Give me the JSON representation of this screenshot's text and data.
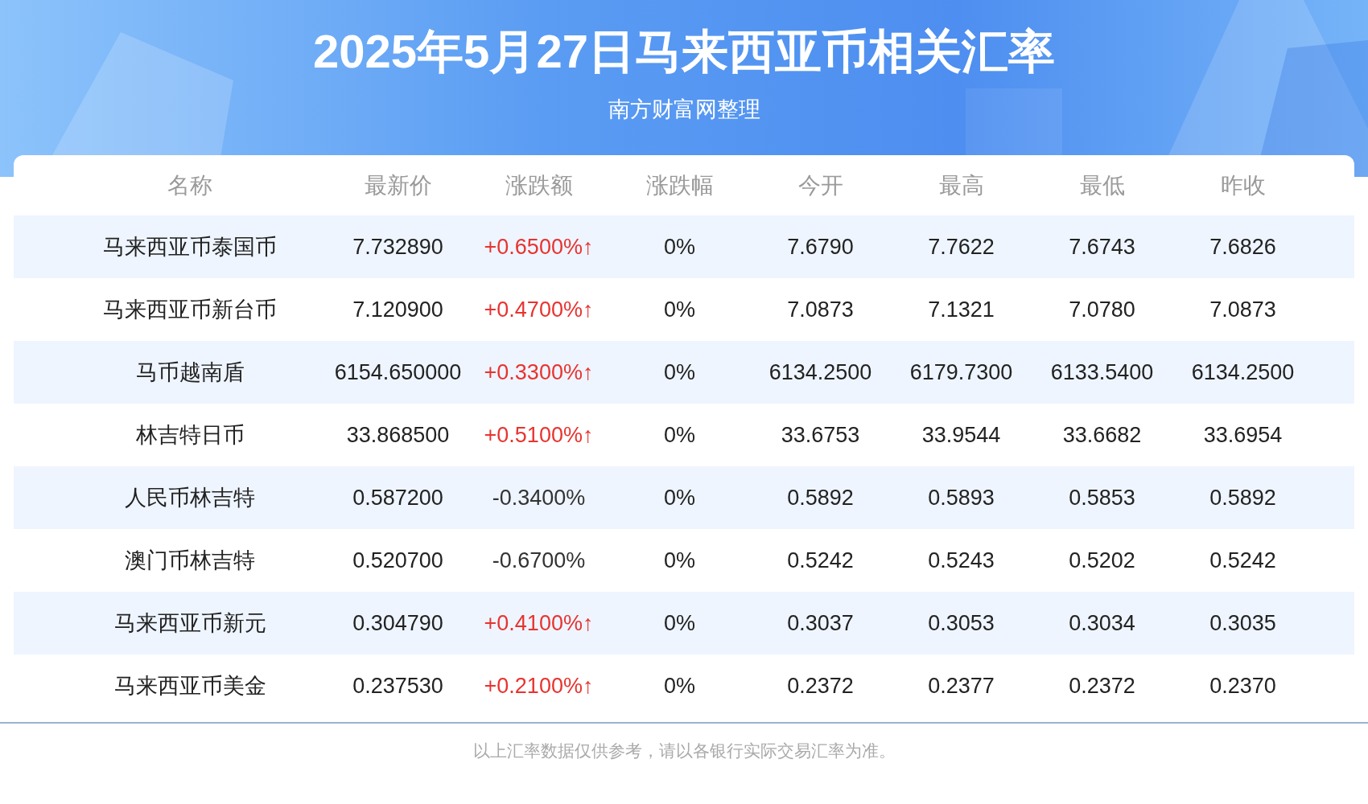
{
  "title": "2025年5月27日马来西亚币相关汇率",
  "subtitle": "南方财富网整理",
  "table": {
    "columns": [
      "名称",
      "最新价",
      "涨跌额",
      "涨跌幅",
      "今开",
      "最高",
      "最低",
      "昨收"
    ],
    "rows": [
      {
        "rising": true,
        "cells": [
          "马来西亚币泰国币",
          "7.732890",
          "+0.6500%↑",
          "0%",
          "7.6790",
          "7.7622",
          "7.6743",
          "7.6826"
        ]
      },
      {
        "rising": true,
        "cells": [
          "马来西亚币新台币",
          "7.120900",
          "+0.4700%↑",
          "0%",
          "7.0873",
          "7.1321",
          "7.0780",
          "7.0873"
        ]
      },
      {
        "rising": true,
        "cells": [
          "马币越南盾",
          "6154.650000",
          "+0.3300%↑",
          "0%",
          "6134.2500",
          "6179.7300",
          "6133.5400",
          "6134.2500"
        ]
      },
      {
        "rising": true,
        "cells": [
          "林吉特日币",
          "33.868500",
          "+0.5100%↑",
          "0%",
          "33.6753",
          "33.9544",
          "33.6682",
          "33.6954"
        ]
      },
      {
        "rising": false,
        "cells": [
          "人民币林吉特",
          "0.587200",
          "-0.3400%",
          "0%",
          "0.5892",
          "0.5893",
          "0.5853",
          "0.5892"
        ]
      },
      {
        "rising": false,
        "cells": [
          "澳门币林吉特",
          "0.520700",
          "-0.6700%",
          "0%",
          "0.5242",
          "0.5243",
          "0.5202",
          "0.5242"
        ]
      },
      {
        "rising": true,
        "cells": [
          "马来西亚币新元",
          "0.304790",
          "+0.4100%↑",
          "0%",
          "0.3037",
          "0.3053",
          "0.3034",
          "0.3035"
        ]
      },
      {
        "rising": true,
        "cells": [
          "马来西亚币美金",
          "0.237530",
          "+0.2100%↑",
          "0%",
          "0.2372",
          "0.2377",
          "0.2372",
          "0.2370"
        ]
      }
    ]
  },
  "footer": "以上汇率数据仅供参考，请以各银行实际交易汇率为准。"
}
